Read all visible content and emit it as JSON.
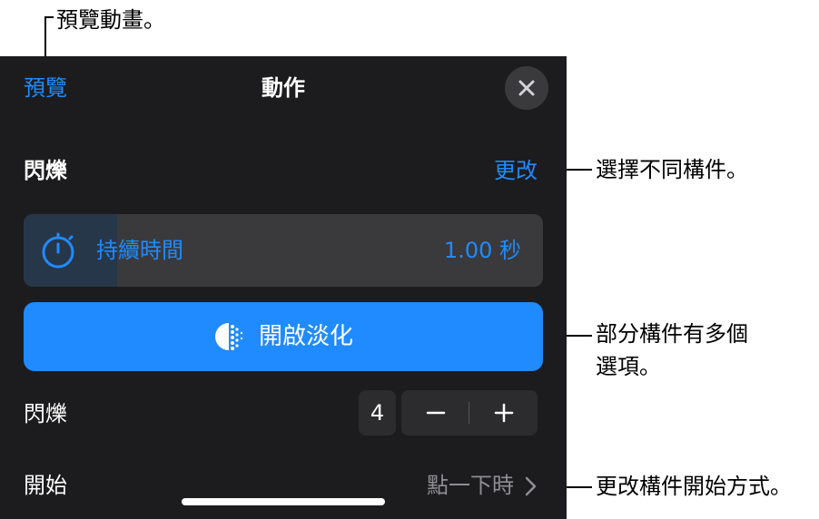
{
  "callouts": {
    "preview": "預覽動畫。",
    "change": "選擇不同構件。",
    "options_line1": "部分構件有多個",
    "options_line2": "選項。",
    "start": "更改構件開始方式。"
  },
  "header": {
    "preview_label": "預覽",
    "title": "動作",
    "close_icon": "close-icon"
  },
  "effect": {
    "name": "閃爍",
    "change_label": "更改"
  },
  "duration": {
    "label": "持續時間",
    "value": "1.00 秒",
    "fill_fraction": 0.18,
    "icon": "stopwatch-icon"
  },
  "fade_button": {
    "label": "開啟淡化",
    "icon": "fade-icon"
  },
  "blink_count": {
    "label": "閃爍",
    "value": "4",
    "minus_icon": "minus-icon",
    "plus_icon": "plus-icon"
  },
  "start": {
    "label": "開始",
    "value": "點一下時",
    "chevron_icon": "chevron-right-icon"
  },
  "colors": {
    "accent": "#1f8bff",
    "panel_bg": "#1c1c1e",
    "control_bg": "#3a3a3c"
  }
}
